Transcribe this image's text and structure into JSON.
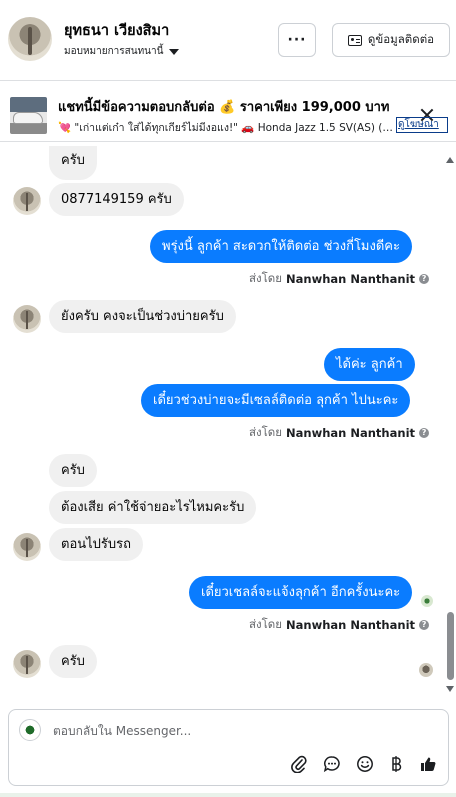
{
  "header": {
    "contact_name": "ยุทธนา เวียงสิมา",
    "assign_label": "มอบหมายการสนทนานี้",
    "more_label": "···",
    "contact_info_label": "ดูข้อมูลติดต่อ"
  },
  "ad": {
    "title": "แชทนี้มีข้อความตอบกลับต่อ 💰 ราคาเพียง 199,000 บาท",
    "description": "💘 \"เก่าแต่เก๋า ใส่ได้ทุกเกียร์ไม่มีงอแง!\" 🚗 Honda Jazz 1.5 SV(AS) (M...",
    "link_label": "ดูโฆษณา"
  },
  "messages": [
    {
      "direction": "in",
      "text": "ครับ"
    },
    {
      "direction": "in",
      "text": "0877149159 ครับ"
    },
    {
      "direction": "out",
      "text": "พรุ่งนี้ ลูกค้า สะดวกให้ติดต่อ ช่วงกี่โมงดีคะ"
    },
    {
      "direction": "out",
      "text": "ได้ค่ะ  ลูกค้า"
    },
    {
      "direction": "out",
      "text": "เดี๋ยวช่วงบ่ายจะมีเซลล์ติดต่อ ลุกค้า ไปนะคะ"
    },
    {
      "direction": "in",
      "text": "ยังครับ คงจะเป็นช่วงบ่ายครับ"
    },
    {
      "direction": "in",
      "text": "ครับ"
    },
    {
      "direction": "in",
      "text": "ต้องเสีย ค่าใช้จ่ายอะไรไหมคะรับ"
    },
    {
      "direction": "in",
      "text": "ตอนไปรับรถ"
    },
    {
      "direction": "out",
      "text": "เดี๋ยวเชลล์จะแจ้งลุกค้า อีกครั้งนะคะ"
    },
    {
      "direction": "in",
      "text": "ครับ"
    }
  ],
  "sent_by": {
    "prefix": "ส่งโดย",
    "agent": "Nanwhan Nanthanit",
    "info_glyph": "?"
  },
  "composer": {
    "placeholder": "ตอบกลับใน Messenger..."
  },
  "icons": {
    "more": "ellipsis-icon",
    "contact": "id-card-icon",
    "close": "close-icon",
    "attach": "paperclip-icon",
    "saved_replies": "chat-bubble-icon",
    "emoji": "emoji-icon",
    "payment": "baht-icon",
    "like": "thumbs-up-icon"
  },
  "colors": {
    "outgoing_bubble": "#0a7cff",
    "incoming_bubble": "#f0f0f0",
    "link": "#0a3c8a"
  }
}
